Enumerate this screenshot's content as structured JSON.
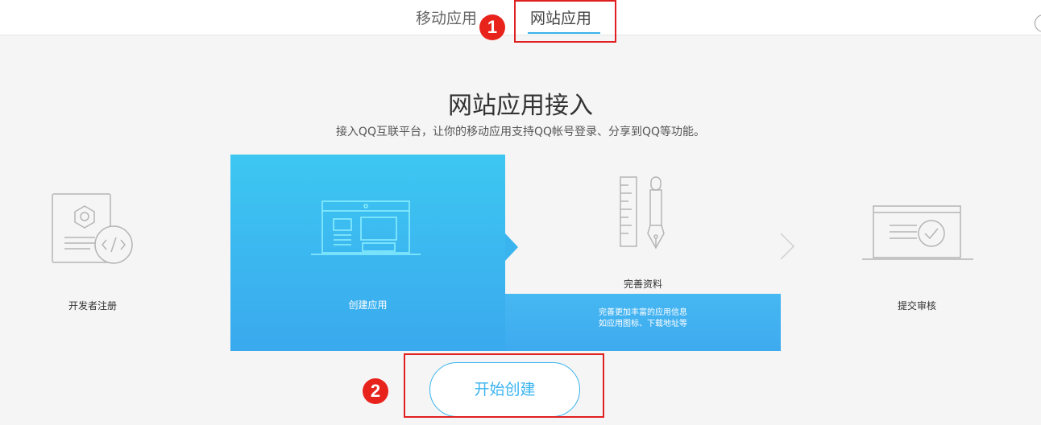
{
  "tabs": [
    {
      "label": "移动应用"
    },
    {
      "label": "网站应用"
    }
  ],
  "annotations": [
    "1",
    "2"
  ],
  "header": {
    "title": "网站应用接入",
    "subtitle": "接入QQ互联平台，让你的移动应用支持QQ帐号登录、分享到QQ等功能。"
  },
  "steps": [
    {
      "label": "开发者注册",
      "icon": "developer-register-icon"
    },
    {
      "label": "创建应用",
      "icon": "create-app-icon"
    },
    {
      "label": "完善资料",
      "icon": "ruler-pen-icon",
      "desc": [
        "完善更加丰富的应用信息",
        "如应用图标、下载地址等"
      ]
    },
    {
      "label": "提交审核",
      "icon": "submit-review-icon"
    }
  ],
  "start_button": {
    "label": "开始创建"
  },
  "colors": {
    "accent": "#3ab4ef",
    "annotation": "#e8231c"
  }
}
